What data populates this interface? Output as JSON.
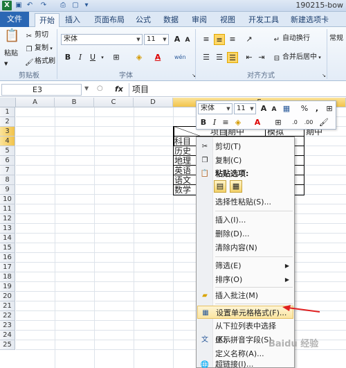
{
  "window": {
    "title": "190215-bow",
    "app_icon": "X"
  },
  "qat": {
    "icons": [
      "save-icon",
      "undo-icon",
      "redo-icon",
      "print-preview-icon",
      "new-icon"
    ]
  },
  "tabs": {
    "file": "文件",
    "home": "开始",
    "insert": "插入",
    "page_layout": "页面布局",
    "formulas": "公式",
    "data": "数据",
    "review": "审阅",
    "view": "视图",
    "developer": "开发工具",
    "new_tab": "新建选项卡"
  },
  "ribbon": {
    "paste": "粘贴",
    "cut": "剪切",
    "copy": "复制",
    "format_painter": "格式刷",
    "clipboard_group": "剪贴板",
    "font_name": "宋体",
    "font_size": "11",
    "bold": "B",
    "italic": "I",
    "underline": "U",
    "grow_font": "A",
    "shrink_font": "A",
    "font_group": "字体",
    "wrap_text": "自动换行",
    "merge_center": "合并后居中",
    "alignment_group": "对齐方式",
    "number_format": "常规",
    "phonetic": "wén"
  },
  "formula_bar": {
    "name_box": "E3",
    "fx": "fx",
    "value": "项目"
  },
  "grid": {
    "columns": [
      "A",
      "B",
      "C",
      "D",
      "E"
    ],
    "selected_column": "E",
    "rows": [
      "1",
      "2",
      "3",
      "4",
      "5",
      "6",
      "7",
      "8",
      "9",
      "10",
      "11",
      "12",
      "13",
      "14",
      "15",
      "16",
      "17",
      "18",
      "19",
      "20",
      "21",
      "22",
      "23",
      "24",
      "25"
    ],
    "selected_rows": [
      "3",
      "4"
    ],
    "cells": {
      "e3_a": "项目",
      "e3_b": "期中",
      "e3_c": "模拟",
      "e3_d": "期中",
      "e4": "科目",
      "e5": "历史",
      "e6": "地理",
      "e7": "英语",
      "e8": "语文",
      "e9": "数学"
    }
  },
  "mini_toolbar": {
    "font_name": "宋体",
    "font_size": "11",
    "grow_font": "A",
    "shrink_font": "A",
    "percent": "%",
    "comma": ",",
    "bold": "B",
    "italic": "I",
    "align": "≡"
  },
  "context_menu": {
    "items": [
      {
        "label": "剪切(T)",
        "icon": "scissors-icon"
      },
      {
        "label": "复制(C)",
        "icon": "copy-icon"
      },
      {
        "label": "粘贴选项:",
        "icon": "paste-icon"
      },
      {
        "label": "选择性粘贴(S)...",
        "icon": ""
      },
      {
        "label": "插入(I)...",
        "icon": ""
      },
      {
        "label": "删除(D)...",
        "icon": ""
      },
      {
        "label": "清除内容(N)",
        "icon": ""
      },
      {
        "label": "筛选(E)",
        "icon": "",
        "submenu": true
      },
      {
        "label": "排序(O)",
        "icon": "",
        "submenu": true
      },
      {
        "label": "插入批注(M)",
        "icon": "comment-icon"
      },
      {
        "label": "设置单元格格式(F)...",
        "icon": "format-cells-icon",
        "highlighted": true
      },
      {
        "label": "从下拉列表中选择(K)...",
        "icon": ""
      },
      {
        "label": "显示拼音字段(S)",
        "icon": "phonetic-icon"
      },
      {
        "label": "定义名称(A)...",
        "icon": ""
      },
      {
        "label": "超链接(I)...",
        "icon": "hyperlink-icon"
      }
    ]
  },
  "colors": {
    "accent": "#2a67b4",
    "highlight": "#fbe5a0",
    "arrow": "#e02020"
  },
  "watermark": "Baidu 经验"
}
